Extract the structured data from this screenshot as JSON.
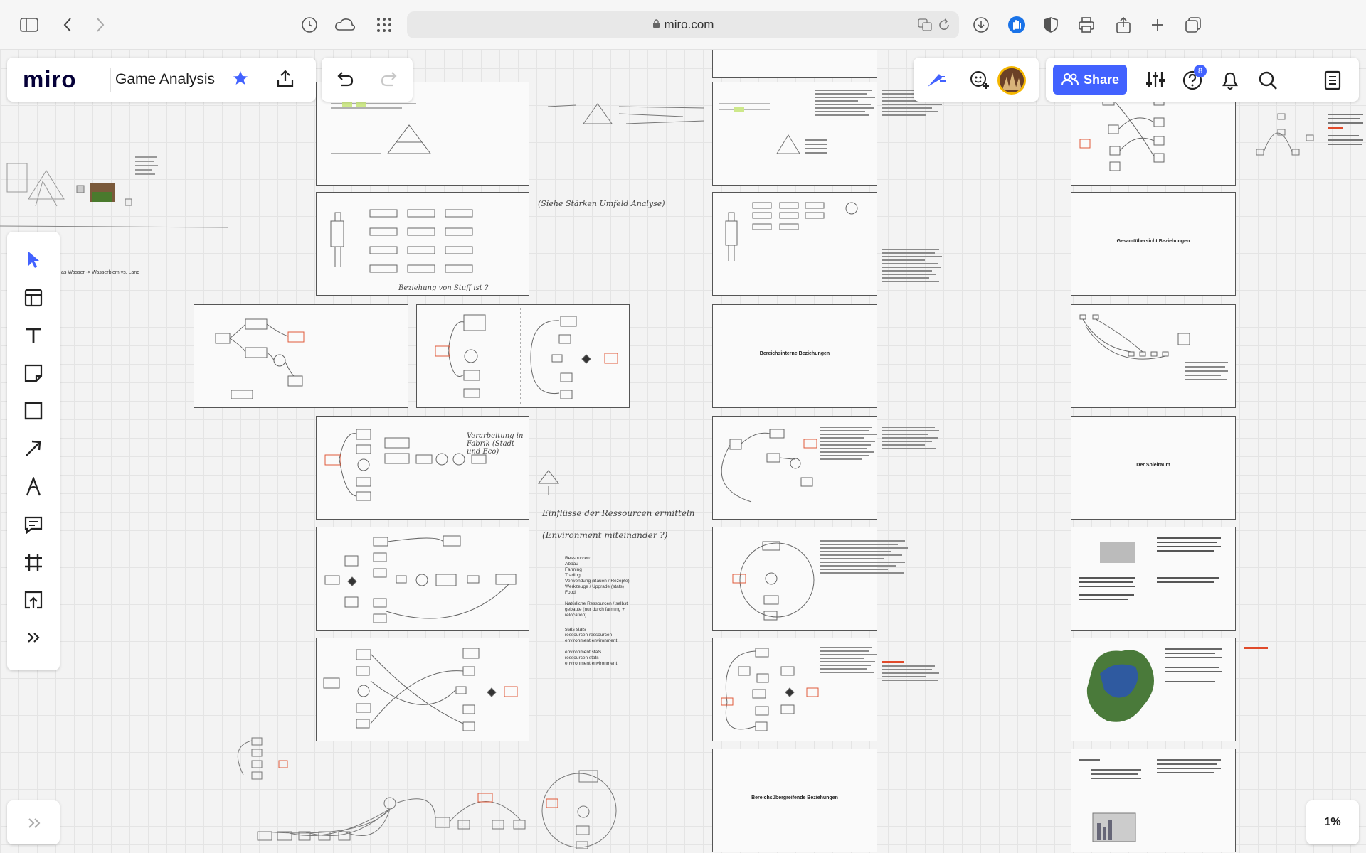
{
  "browser": {
    "url": "miro.com"
  },
  "board": {
    "logo": "miro",
    "title": "Game Analysis",
    "share_label": "Share",
    "notification_count": "8",
    "zoom": "1%"
  },
  "canvas": {
    "left_note": "as Wasser -> Wasserbiem vs. Land",
    "frame_titles": {
      "bereichsinterne": "Bereichsinterne Beziehungen",
      "bereichsuebergreifende": "Bereichsübergreifende Beziehungen",
      "gesamtuebersicht": "Gesamtübersicht Beziehungen",
      "spielraum": "Der Spielraum"
    },
    "handwritten": {
      "note1": "(Siehe Stärken Umfeld Analyse)",
      "note2": "Beziehung von Stuff ist ?",
      "note3": "Verarbeitung in Fabrik (Stadt und Eco)",
      "note4": "Einflüsse der Ressourcen ermitteln",
      "note5": "(Environment miteinander ?)"
    },
    "resource_list": "Ressourcen:\nAbbau\nFarming\nTrading\nVerwendung (Bauen / Rezepte)\nWerkzeuge / Upgrade (stats)\nFood\n\nNatürliche Ressourcen / selbst\ngebaute (nur durch farming +\nrelocation)",
    "stats_list": "stats stats\nressourcen ressourcen\nenvironment environment\n\nenvironment stats\nressourcen stats\nenvironment environment"
  },
  "colors": {
    "accent": "#4262ff",
    "avatar_ring": "#f5b700"
  }
}
